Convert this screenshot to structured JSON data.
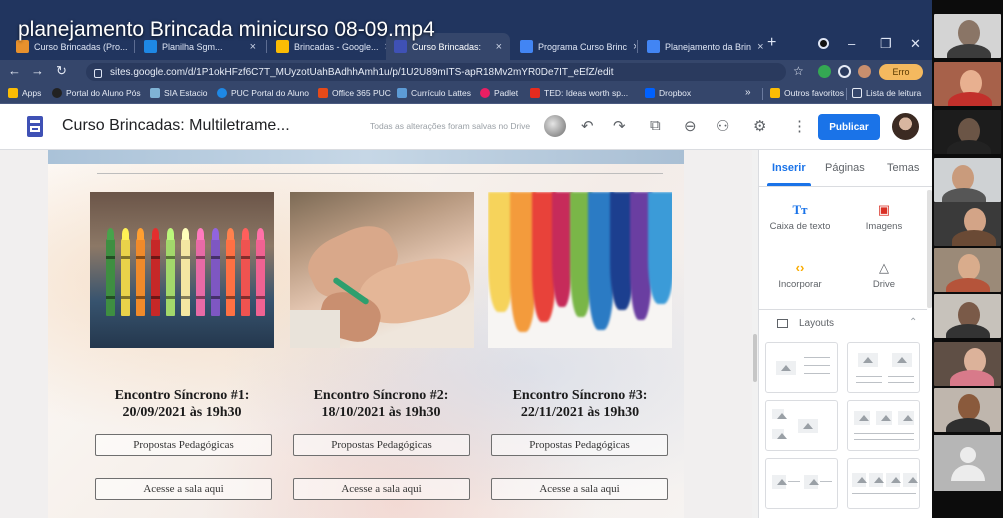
{
  "video_title": "planejamento Brincada minicurso 08-09.mp4",
  "tabs": [
    {
      "label": "Curso Brincadas (Pro...",
      "color": "#e8912d",
      "active": false
    },
    {
      "label": "Planilha Sgm...",
      "color": "#1e88e5",
      "active": false
    },
    {
      "label": "Brincadas - Google...",
      "color": "#fbbc04",
      "active": false
    },
    {
      "label": "Curso Brincadas:",
      "color": "#3f51b5",
      "active": true
    },
    {
      "label": "Programa Curso Brinc",
      "color": "#4285f4",
      "active": false
    },
    {
      "label": "Planejamento da Brin",
      "color": "#4285f4",
      "active": false
    }
  ],
  "address_bar": {
    "url": "sites.google.com/d/1P1okHFzf6C7T_MUyzotUahBAdhhAmh1u/p/1U2U89mITS-apR18Mv2mYR0De7IT_eEfZ/edit",
    "profile_badge": "Erro"
  },
  "bookmarks": [
    {
      "label": "Apps",
      "color": "#fbbc04"
    },
    {
      "label": "Portal do Aluno Pós",
      "color": "#222222"
    },
    {
      "label": "SIA Estacio",
      "color": "#7fb3d5"
    },
    {
      "label": "PUC Portal do Aluno",
      "color": "#1e88e5"
    },
    {
      "label": "Office 365 PUC",
      "color": "#e64a19"
    },
    {
      "label": "Currículo Lattes",
      "color": "#5c9bd6"
    },
    {
      "label": "Padlet",
      "color": "#e91e63"
    },
    {
      "label": "TED: Ideas worth sp...",
      "color": "#e62b1e"
    },
    {
      "label": "Dropbox",
      "color": "#0061ff"
    },
    {
      "label": "Outros favoritos",
      "color": "#fbbc04"
    },
    {
      "label": "Lista de leitura",
      "color": "#e6ebf5"
    }
  ],
  "sites_toolbar": {
    "site_name": "Curso Brincadas: Multiletrame...",
    "save_status": "Todas as alterações foram salvas no Drive",
    "publish_label": "Publicar"
  },
  "sessions": [
    {
      "title": "Encontro Síncrono #1:",
      "date": "20/09/2021 às 19h30",
      "button_1": "Propostas Pedagógicas",
      "button_2": "Acesse a sala aqui"
    },
    {
      "title": "Encontro Síncrono #2:",
      "date": "18/10/2021 às 19h30",
      "button_1": "Propostas Pedagógicas",
      "button_2": "Acesse a sala aqui"
    },
    {
      "title": "Encontro Síncrono #3:",
      "date": "22/11/2021 às 19h30",
      "button_1": "Propostas Pedagógicas",
      "button_2": "Acesse a sala aqui"
    }
  ],
  "side_panel": {
    "tabs": [
      "Inserir",
      "Páginas",
      "Temas"
    ],
    "insert_items": [
      "Caixa de texto",
      "Imagens",
      "Incorporar",
      "Drive"
    ],
    "layouts_label": "Layouts"
  },
  "colors": {
    "browser_frame": "#21355f",
    "accent": "#1a73e8",
    "sites_brand": "#3f51b5"
  }
}
